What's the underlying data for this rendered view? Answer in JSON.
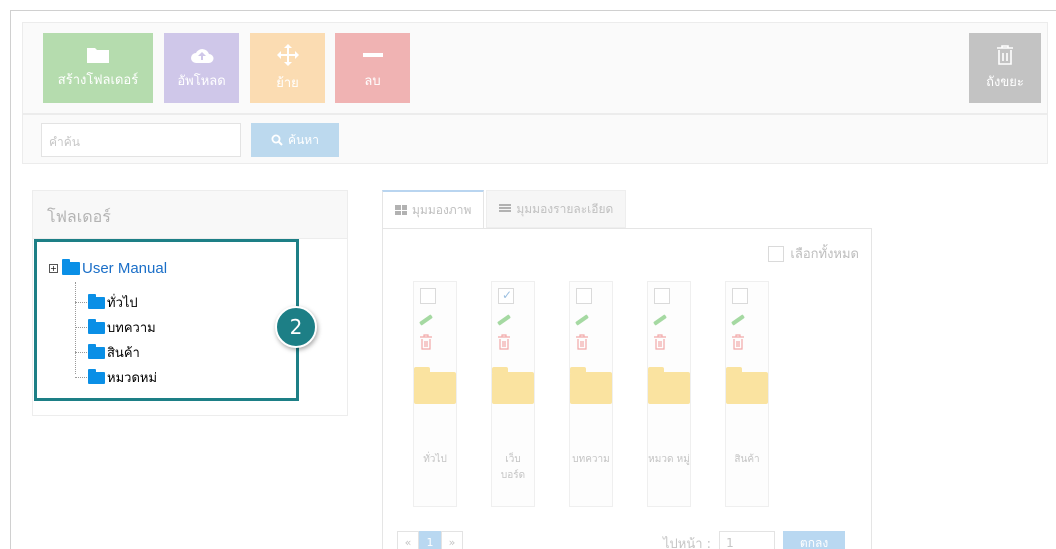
{
  "toolbar": {
    "create_folder": "สร้างโฟลเดอร์",
    "upload": "อัพโหลด",
    "move": "ย้าย",
    "delete": "ลบ",
    "trash": "ถังขยะ"
  },
  "search": {
    "placeholder": "คำค้น",
    "button": "ค้นหา"
  },
  "folder_panel": {
    "title": "โฟลเดอร์",
    "root": "User Manual",
    "children": [
      "ทั่วไป",
      "บทความ",
      "สินค้า",
      "หมวดหม่"
    ]
  },
  "step_badge": "2",
  "view_tabs": {
    "thumbnail": "มุมมองภาพ",
    "detail": "มุมมองรายละเอียด"
  },
  "select_all": "เลือกทั้งหมด",
  "items": [
    {
      "name": "ทั่วไป",
      "checked": false
    },
    {
      "name": "เว็บ บอร์ด",
      "checked": true
    },
    {
      "name": "บทความ",
      "checked": false
    },
    {
      "name": "หมวด หมู่",
      "checked": false
    },
    {
      "name": "สินค้า",
      "checked": false
    }
  ],
  "pagination": {
    "prev": "«",
    "current": "1",
    "next": "»",
    "goto_label": "ไปหน้า :",
    "goto_value": "1",
    "goto_button": "ตกลง"
  },
  "colors": {
    "create": "#b5dcae",
    "upload": "#cfc7e9",
    "move": "#fbdcb2",
    "delete": "#f0b3b3",
    "trash": "#c3c3c3",
    "highlight": "#1d7f86",
    "folder_icon": "#0a8fe6"
  }
}
